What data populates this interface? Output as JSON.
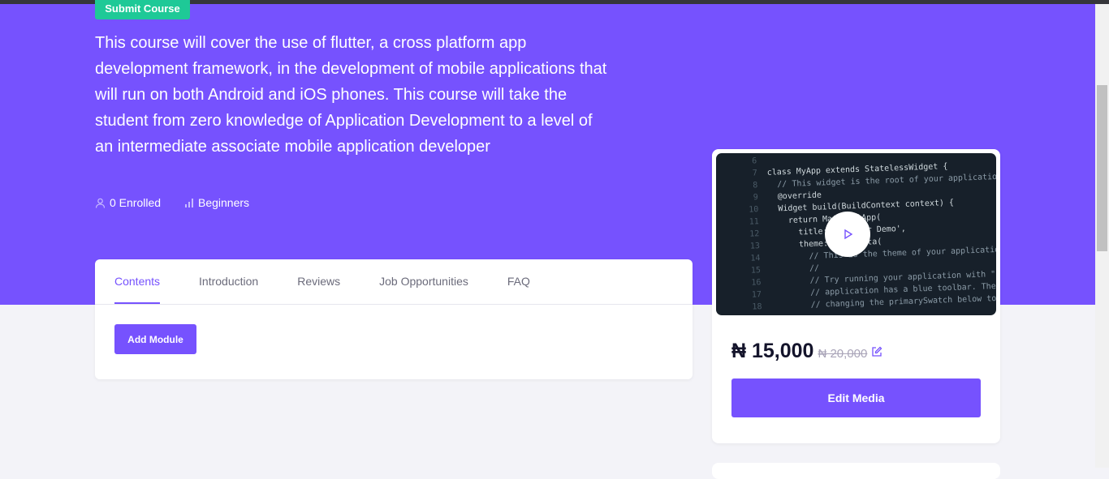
{
  "hero": {
    "submit_label": "Submit Course",
    "description": "This course will cover the use of flutter, a cross platform app development framework, in the development of mobile applications that will run on both Android and iOS phones. This course will take the student from zero knowledge of Application Development to a level of an intermediate associate mobile application developer",
    "enrolled": "0 Enrolled",
    "level": "Beginners"
  },
  "tabs": [
    {
      "label": "Contents"
    },
    {
      "label": "Introduction"
    },
    {
      "label": "Reviews"
    },
    {
      "label": "Job Opportunities"
    },
    {
      "label": "FAQ"
    }
  ],
  "add_module_label": "Add Module",
  "media": {
    "code_lines": [
      [
        "6",
        ""
      ],
      [
        "7",
        "class MyApp extends StatelessWidget {"
      ],
      [
        "8",
        "  // This widget is the root of your application."
      ],
      [
        "9",
        "  @override"
      ],
      [
        "10",
        "  Widget build(BuildContext context) {"
      ],
      [
        "11",
        "    return MaterialApp("
      ],
      [
        "12",
        "      title: 'Flutter Demo',"
      ],
      [
        "13",
        "      theme: ThemeData("
      ],
      [
        "14",
        "        // This is the theme of your application."
      ],
      [
        "15",
        "        //"
      ],
      [
        "16",
        "        // Try running your application with \"flutter"
      ],
      [
        "17",
        "        // application has a blue toolbar. Then, wit"
      ],
      [
        "18",
        "        // changing the primarySwatch below to Colors"
      ]
    ]
  },
  "pricing": {
    "price": "₦ 15,000",
    "old_price": "₦ 20,000",
    "edit_media_label": "Edit Media"
  },
  "colors": {
    "primary": "#7652fe",
    "success": "#1ec997"
  }
}
